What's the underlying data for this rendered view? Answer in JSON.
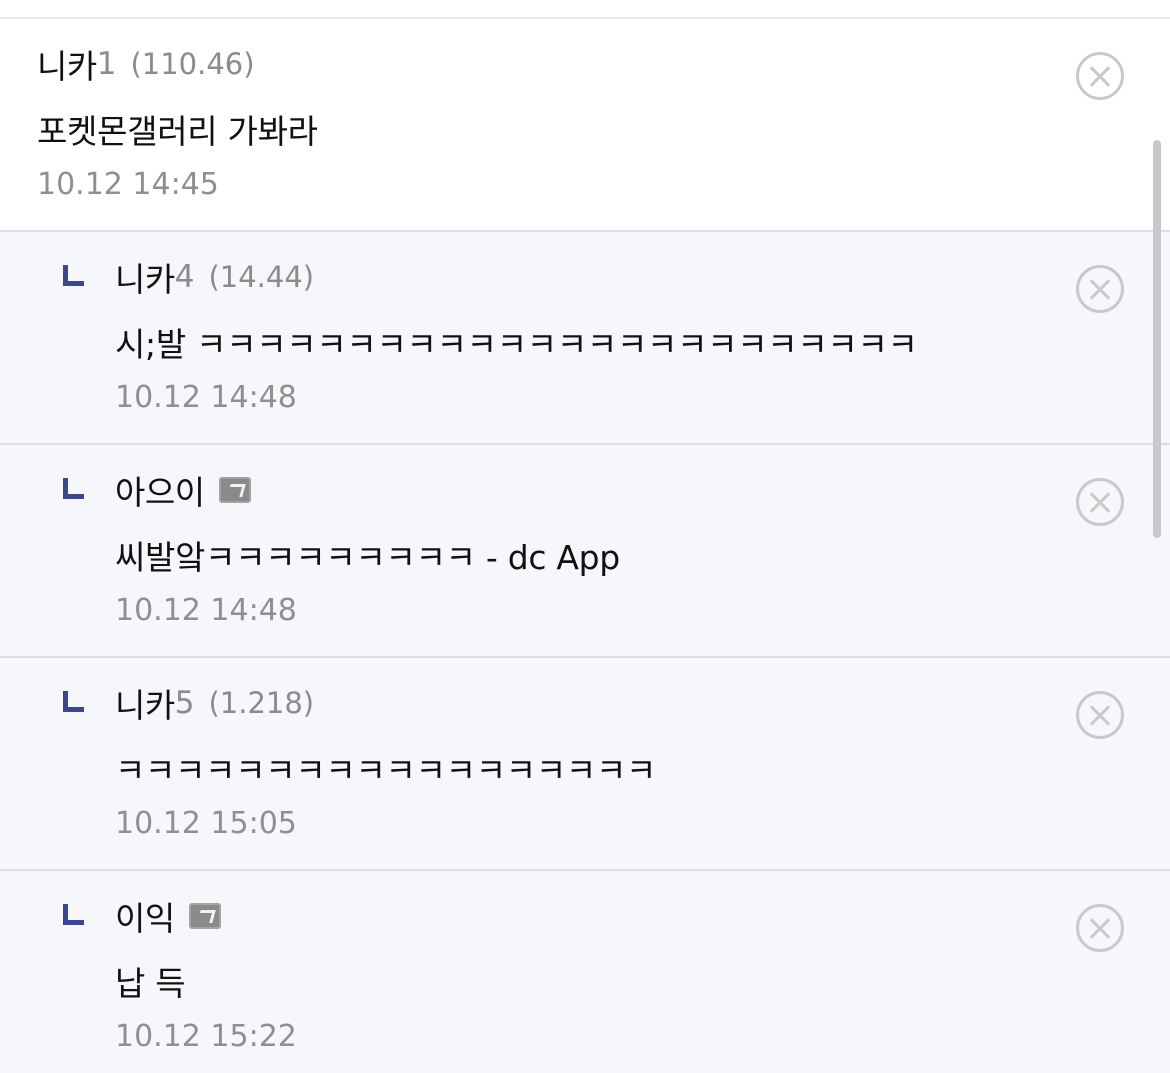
{
  "comments": [
    {
      "nick": "니카",
      "nick_num": "1",
      "ip": "(110.46)",
      "text": "포켓몬갤러리 가봐라",
      "date": "10.12 14:45"
    },
    {
      "nick": "니카",
      "nick_num": "4",
      "ip": "(14.44)",
      "text": "시;발 ㅋㅋㅋㅋㅋㅋㅋㅋㅋㅋㅋㅋㅋㅋㅋㅋㅋㅋㅋㅋㅋㅋㅋㅋ",
      "date": "10.12 14:48"
    },
    {
      "nick": "아으이",
      "text": "씨발앜ㅋㅋㅋㅋㅋㅋㅋㅋㅋ - dc App",
      "date": "10.12 14:48",
      "icon": "fixed-nick-icon"
    },
    {
      "nick": "니카",
      "nick_num": "5",
      "ip": "(1.218)",
      "text": "ㅋㅋㅋㅋㅋㅋㅋㅋㅋㅋㅋㅋㅋㅋㅋㅋㅋㅋ",
      "date": "10.12 15:05"
    },
    {
      "nick": "이익",
      "text": "납 득",
      "date": "10.12 15:22",
      "icon": "fixed-nick-icon"
    }
  ],
  "icons": {
    "reply": "reply-arrow-icon",
    "delete": "close-circle-icon"
  },
  "colors": {
    "reply_bg": "#f6f7fa",
    "reply_marker": "#3b4890",
    "meta_text": "#8f8f8f"
  }
}
